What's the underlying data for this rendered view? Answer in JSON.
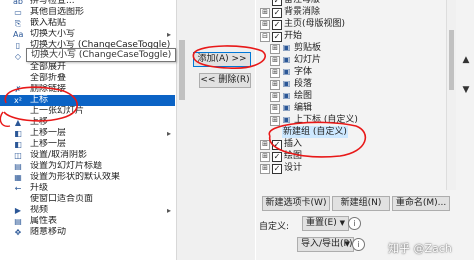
{
  "left_list": {
    "items": [
      {
        "icon": "spellcheck-icon",
        "glyph": "ab",
        "label": "拼写检查..."
      },
      {
        "icon": "shape-icon",
        "glyph": "▭",
        "label": "其他自选图形"
      },
      {
        "icon": "paste-icon",
        "glyph": "⎘",
        "label": "嵌入粘贴"
      },
      {
        "icon": "case-icon",
        "glyph": "Aa",
        "label": "切换大小写",
        "sub": "▸"
      },
      {
        "icon": "tag-icon",
        "glyph": "▯",
        "label": "切换大小写 (ChangeCaseToggle)"
      },
      {
        "icon": "eraser-icon",
        "glyph": "◇",
        "label": ""
      },
      {
        "icon": "expand-icon",
        "glyph": "",
        "label": "全部展开"
      },
      {
        "icon": "collapse-icon",
        "glyph": "",
        "label": "全部折叠"
      },
      {
        "icon": "delete-mark-icon",
        "glyph": "✗",
        "label": "删除链接"
      },
      {
        "icon": "superscript-icon",
        "glyph": "x²",
        "label": "上标",
        "selected": true
      },
      {
        "icon": "slide-icon",
        "glyph": "",
        "label": "上一张幻灯片"
      },
      {
        "icon": "move-up-icon",
        "glyph": "▲",
        "label": "上移"
      },
      {
        "icon": "move-up-layer-icon",
        "glyph": "◧",
        "label": "上移一层",
        "sub": "▸"
      },
      {
        "icon": "move-up-layer2-icon",
        "glyph": "◧",
        "label": "上移一层"
      },
      {
        "icon": "shadow-icon",
        "glyph": "◫",
        "label": "设置/取消阴影"
      },
      {
        "icon": "title-icon",
        "glyph": "▤",
        "label": "设置为幻灯片标题"
      },
      {
        "icon": "default-icon",
        "glyph": "▦",
        "label": "设置为形状的默认效果"
      },
      {
        "icon": "promote-icon",
        "glyph": "←",
        "label": "升级"
      },
      {
        "icon": "fit-icon",
        "glyph": "",
        "label": "使窗口适合页面"
      },
      {
        "icon": "video-icon",
        "glyph": "▶",
        "label": "视频",
        "sub": "▸"
      },
      {
        "icon": "properties-icon",
        "glyph": "▤",
        "label": "属性表"
      },
      {
        "icon": "move-icon",
        "glyph": "✥",
        "label": "随意移动"
      }
    ],
    "tooltip": "切换大小写 (ChangeCaseToggle)"
  },
  "buttons": {
    "add": "添加(A) >>",
    "remove": "<< 删除(R)",
    "new_tab": "新建选项卡(W)",
    "new_group": "新建组(N)",
    "rename": "重命名(M)...",
    "reset": "重置(E)",
    "import_export": "导入/导出(P)"
  },
  "tree": {
    "nodes": [
      {
        "level": 0,
        "exp": "",
        "check": "✓",
        "label": "备注母版"
      },
      {
        "level": 0,
        "exp": "⊞",
        "check": "✓",
        "label": "背景消除"
      },
      {
        "level": 0,
        "exp": "⊞",
        "check": "✓",
        "label": "主页(母版视图)"
      },
      {
        "level": 0,
        "exp": "⊟",
        "check": "✓",
        "label": "开始"
      },
      {
        "level": 1,
        "exp": "⊞",
        "icon": "▣",
        "label": "剪贴板"
      },
      {
        "level": 1,
        "exp": "⊞",
        "icon": "▣",
        "label": "幻灯片"
      },
      {
        "level": 1,
        "exp": "⊞",
        "icon": "▣",
        "label": "字体"
      },
      {
        "level": 1,
        "exp": "⊞",
        "icon": "▣",
        "label": "段落"
      },
      {
        "level": 1,
        "exp": "⊞",
        "icon": "▣",
        "label": "绘图"
      },
      {
        "level": 1,
        "exp": "⊞",
        "icon": "▣",
        "label": "编辑"
      },
      {
        "level": 1,
        "exp": "⊞",
        "icon": "▣",
        "label": "上下标 (自定义)"
      },
      {
        "level": 1,
        "exp": "",
        "icon": "",
        "label": "新建组 (自定义)",
        "highlighted": true
      },
      {
        "level": 0,
        "exp": "⊞",
        "check": "✓",
        "label": "插入"
      },
      {
        "level": 0,
        "exp": "⊞",
        "check": "✓",
        "label": "绘图"
      },
      {
        "level": 0,
        "exp": "⊞",
        "check": "✓",
        "label": "设计"
      }
    ]
  },
  "customize_label": "自定义:",
  "watermark": "知乎 @Zach",
  "colors": {
    "selection": "#0b63c5",
    "annotation": "#e81818",
    "tree_highlight": "#cde8ff"
  }
}
